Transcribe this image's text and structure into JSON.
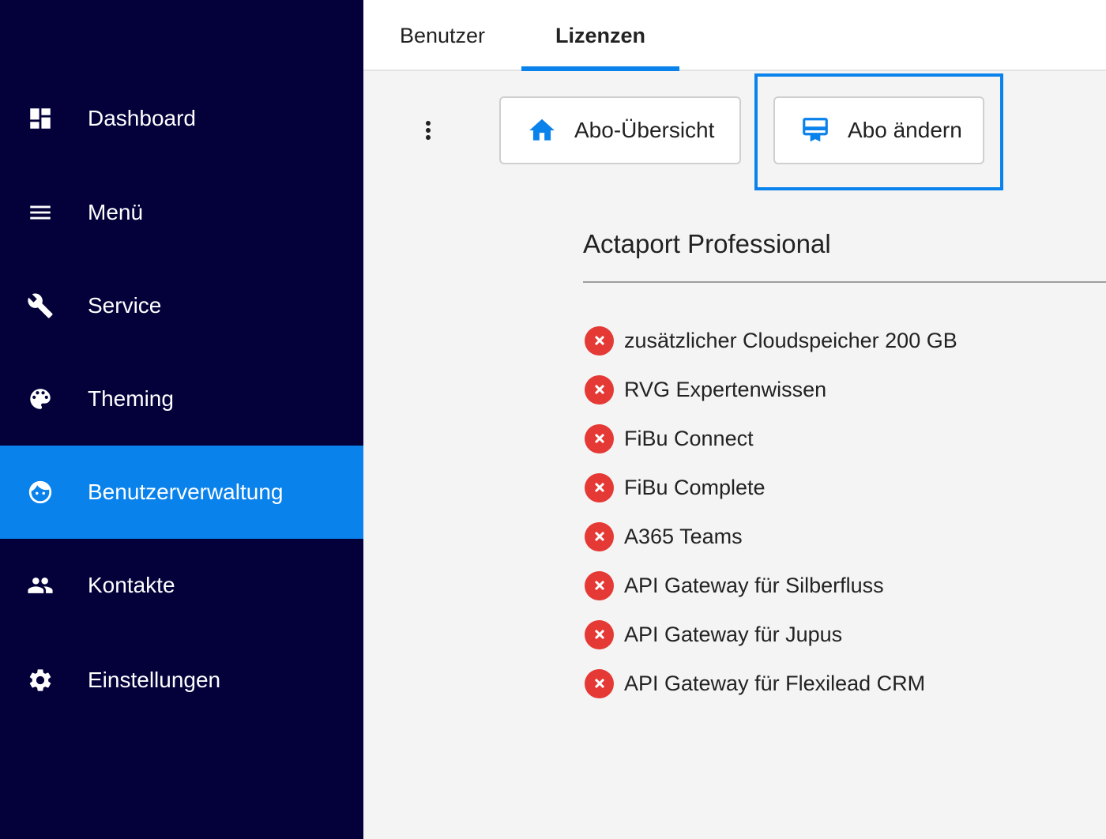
{
  "sidebar": {
    "items": [
      {
        "label": "Dashboard",
        "icon": "dashboard-icon"
      },
      {
        "label": "Menü",
        "icon": "menu-icon"
      },
      {
        "label": "Service",
        "icon": "wrench-icon"
      },
      {
        "label": "Theming",
        "icon": "palette-icon"
      },
      {
        "label": "Benutzerverwaltung",
        "icon": "user-face-icon",
        "active": true
      },
      {
        "label": "Kontakte",
        "icon": "people-icon"
      },
      {
        "label": "Einstellungen",
        "icon": "gear-icon"
      }
    ],
    "background": "#03003a",
    "active_color": "#0a82ec"
  },
  "tabs": [
    {
      "label": "Benutzer"
    },
    {
      "label": "Lizenzen",
      "active": true
    }
  ],
  "toolbar": {
    "overview_label": "Abo-Übersicht",
    "overview_icon": "home-icon",
    "change_label": "Abo ändern",
    "change_icon": "certificate-icon",
    "more_icon": "more-vertical-icon"
  },
  "plan": {
    "title": "Actaport Professional",
    "features": [
      {
        "label": "zusätzlicher Cloudspeicher 200 GB",
        "included": false
      },
      {
        "label": "RVG Expertenwissen",
        "included": false
      },
      {
        "label": "FiBu Connect",
        "included": false
      },
      {
        "label": "FiBu Complete",
        "included": false
      },
      {
        "label": "A365 Teams",
        "included": false
      },
      {
        "label": "API Gateway für Silberfluss",
        "included": false
      },
      {
        "label": "API Gateway für Jupus",
        "included": false
      },
      {
        "label": "API Gateway für Flexilead CRM",
        "included": false
      }
    ],
    "excluded_color": "#e53935"
  }
}
